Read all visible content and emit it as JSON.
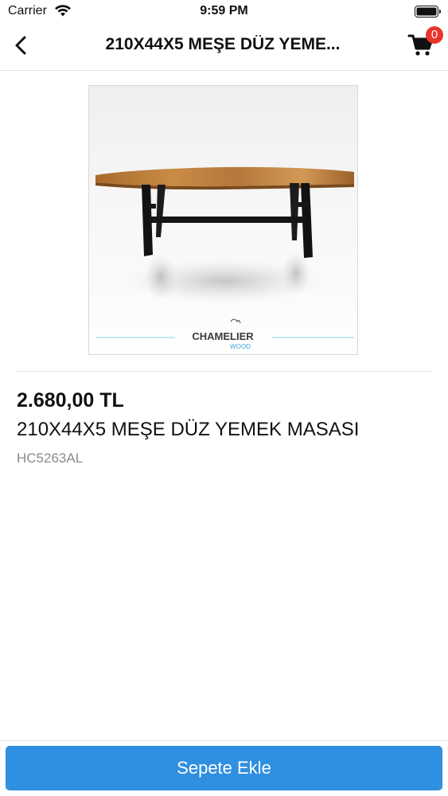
{
  "status_bar": {
    "carrier": "Carrier",
    "time": "9:59 PM"
  },
  "nav": {
    "title": "210X44X5 MEŞE DÜZ YEME...",
    "back_icon": "chevron-left-icon",
    "cart_icon": "shopping-cart-icon",
    "cart_count": "0"
  },
  "product": {
    "image_brand_line1": "CHAMELIER",
    "image_brand_line2": "WOOD",
    "price": "2.680,00 TL",
    "name": "210X44X5 MEŞE DÜZ YEMEK MASASI",
    "code": "HC5263AL"
  },
  "actions": {
    "add_to_cart_label": "Sepete Ekle"
  },
  "colors": {
    "accent": "#2f8fe0",
    "badge": "#e8342b"
  }
}
